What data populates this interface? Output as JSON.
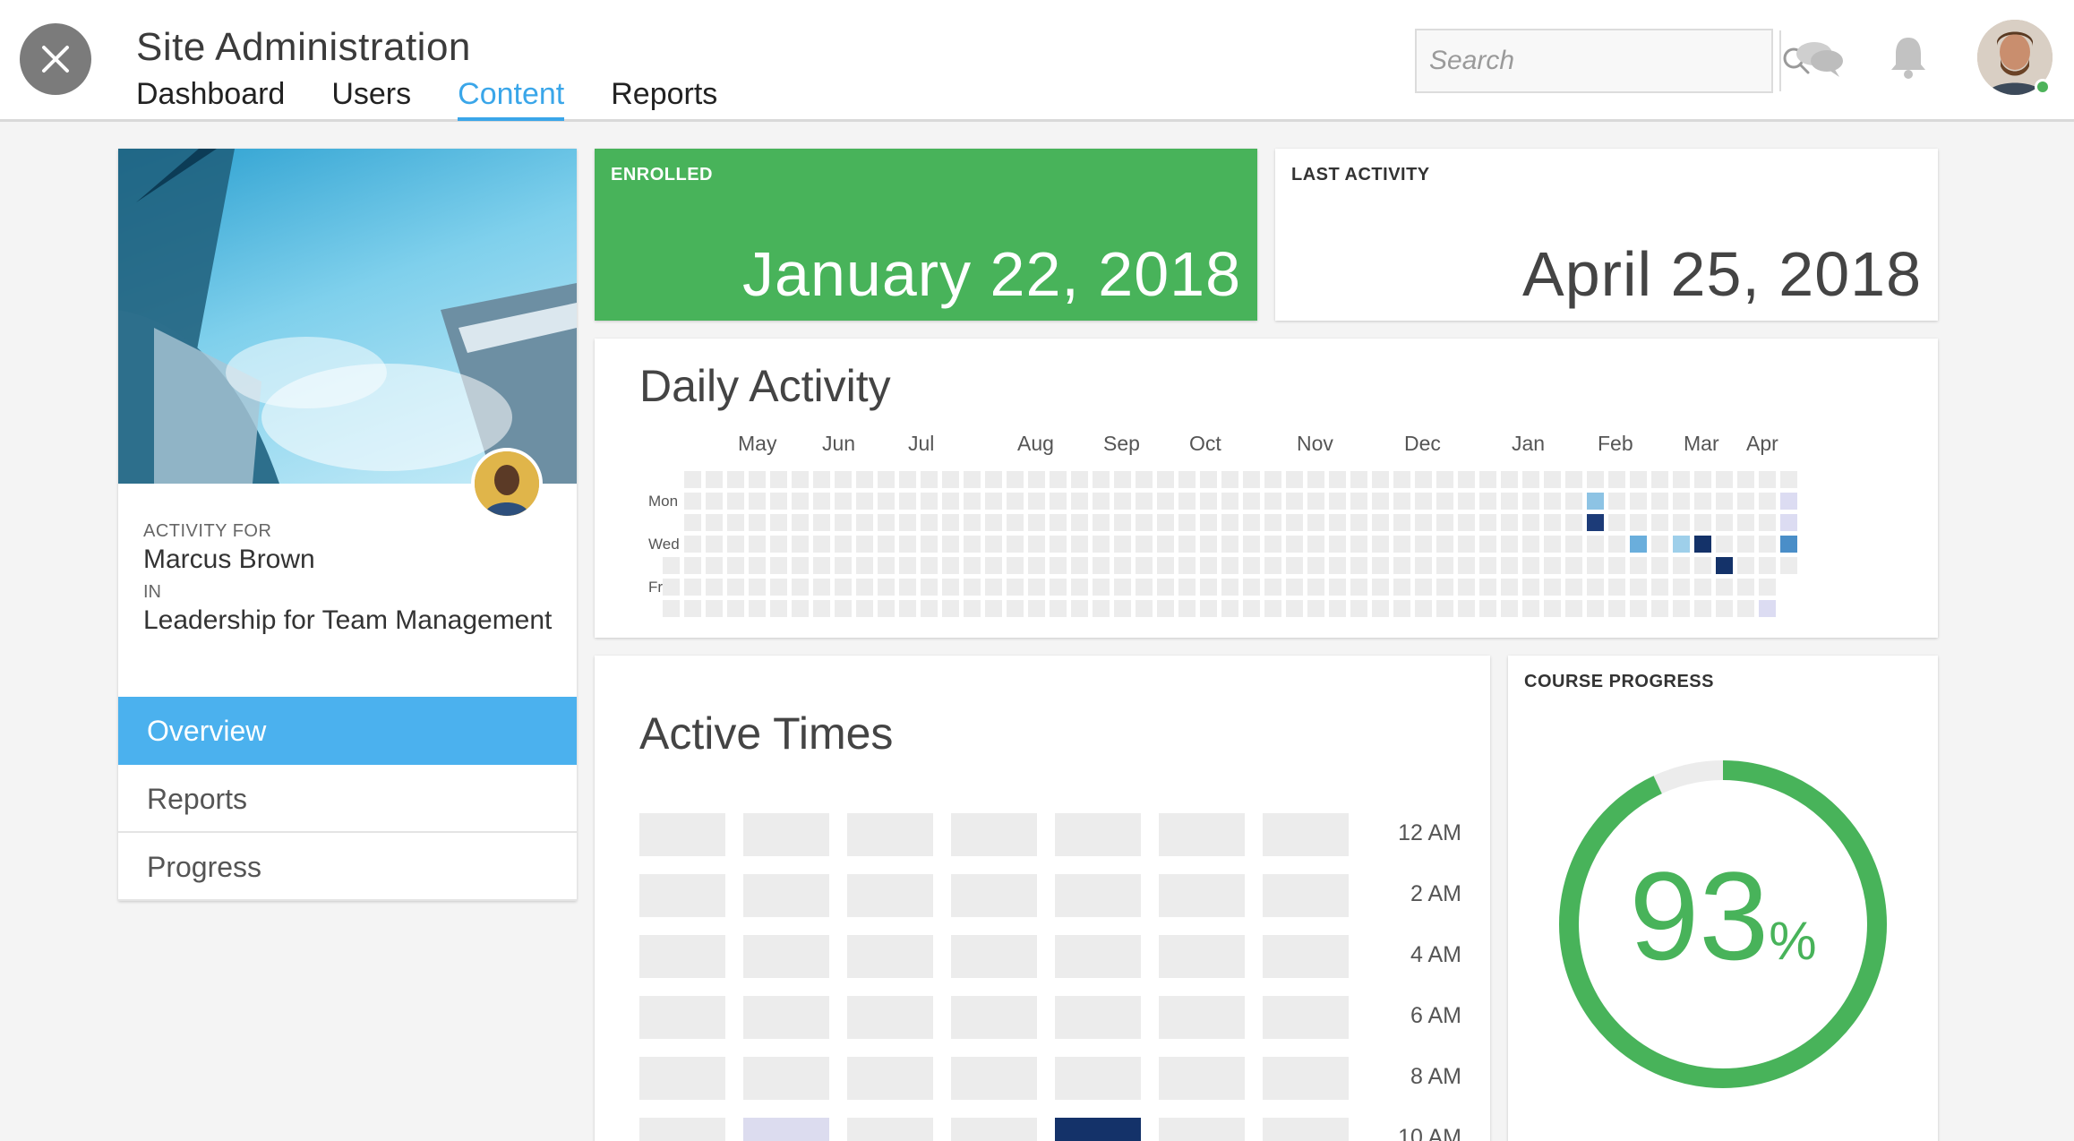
{
  "header": {
    "title": "Site Administration",
    "tabs": [
      {
        "label": "Dashboard",
        "active": false
      },
      {
        "label": "Users",
        "active": false
      },
      {
        "label": "Content",
        "active": true
      },
      {
        "label": "Reports",
        "active": false
      }
    ],
    "search_placeholder": "Search",
    "icons": [
      "close-icon",
      "search-icon",
      "chat-icon",
      "bell-icon"
    ],
    "accent_color": "#3aa6e9"
  },
  "profile": {
    "activity_for_label": "ACTIVITY FOR",
    "user_name": "Marcus Brown",
    "in_label": "IN",
    "course_name": "Leadership for Team Management",
    "menu": [
      {
        "label": "Overview",
        "active": true
      },
      {
        "label": "Reports",
        "active": false
      },
      {
        "label": "Progress",
        "active": false
      }
    ]
  },
  "enrolled": {
    "label": "ENROLLED",
    "date": "January 22, 2018",
    "color": "#48b35a"
  },
  "last_activity": {
    "label": "LAST ACTIVITY",
    "date": "April 25, 2018"
  },
  "daily_activity": {
    "title": "Daily Activity",
    "months": [
      "May",
      "Jun",
      "Jul",
      "Aug",
      "Sep",
      "Oct",
      "Nov",
      "Dec",
      "Jan",
      "Feb",
      "Mar",
      "Apr"
    ],
    "day_labels": [
      "Mon",
      "Wed",
      "Fri"
    ]
  },
  "active_times": {
    "title": "Active Times",
    "hours": [
      "12 AM",
      "2 AM",
      "4 AM",
      "6 AM",
      "8 AM",
      "10 AM"
    ]
  },
  "course_progress": {
    "label": "COURSE PROGRESS",
    "percent": 93,
    "percent_text": "93",
    "percent_sign": "%"
  }
}
